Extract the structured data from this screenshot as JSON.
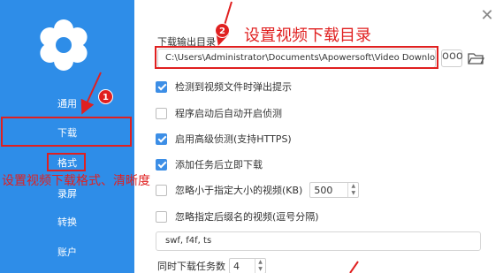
{
  "sidebar": {
    "items": [
      {
        "label": "通用"
      },
      {
        "label": "下载"
      },
      {
        "label": "格式"
      },
      {
        "label": "录屏"
      },
      {
        "label": "转换"
      },
      {
        "label": "账户"
      }
    ]
  },
  "main": {
    "dir_label": "下载输出目录",
    "path_value": "C:\\Users\\Administrator\\Documents\\Apowersoft\\Video Download C",
    "more_label": "ooo",
    "options": [
      {
        "label": "检测到视频文件时弹出提示",
        "checked": true
      },
      {
        "label": "程序启动后自动开启侦测",
        "checked": false
      },
      {
        "label": "启用高级侦测(支持HTTPS)",
        "checked": true
      },
      {
        "label": "添加任务后立即下载",
        "checked": true
      },
      {
        "label": "忽略小于指定大小的视频(KB)",
        "checked": false,
        "value": "500"
      },
      {
        "label": "忽略指定后缀名的视频(逗号分隔)",
        "checked": false
      }
    ],
    "ext_value": "swf, f4f, ts",
    "concurrent_label": "同时下载任务数",
    "concurrent_value": "4"
  },
  "annotations": {
    "badge1": "1",
    "badge2": "2",
    "path_note": "设置视频下载目录",
    "format_note": "设置视频下载格式、清晰度"
  },
  "colors": {
    "sidebar": "#2e8de8",
    "accent": "#3c8ee6",
    "annotation": "#e02020"
  }
}
